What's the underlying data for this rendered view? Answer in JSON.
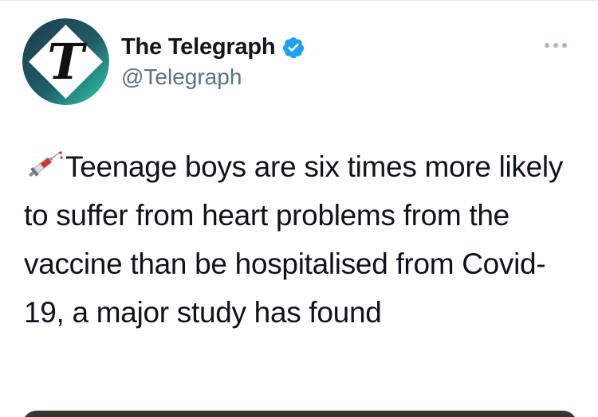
{
  "tweet": {
    "author": {
      "display_name": "The Telegraph",
      "handle": "@Telegraph",
      "verified_icon": "verified-badge-icon",
      "avatar_letter": "T"
    },
    "more_icon": "more-options-icon",
    "emoji_icon": "syringe-icon",
    "text": "Teenage boys are six times more likely to suffer from heart problems from the vaccine than be hospitalised from Covid-19, a major study has found"
  },
  "colors": {
    "verified_blue": "#1da1f2",
    "handle_gray": "#5b7083",
    "logo_teal": "#2bbfa7",
    "logo_navy": "#1e3a4c"
  }
}
